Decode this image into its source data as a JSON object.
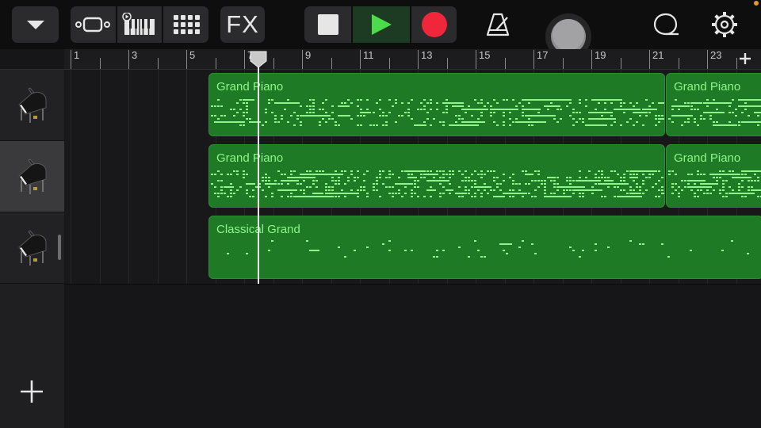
{
  "toolbar": {
    "fx_label": "FX",
    "buttons": [
      {
        "name": "track-menu-button",
        "icon": "chevron-down-icon"
      },
      {
        "name": "browser-button",
        "icon": "browser-icon"
      },
      {
        "name": "instrument-button",
        "icon": "keyboard-icon"
      },
      {
        "name": "smart-controls-button",
        "icon": "grid-icon"
      },
      {
        "name": "fx-button",
        "icon": "fx-icon"
      },
      {
        "name": "stop-button",
        "icon": "stop-icon"
      },
      {
        "name": "play-button",
        "icon": "play-icon"
      },
      {
        "name": "record-button",
        "icon": "record-icon"
      },
      {
        "name": "metronome-button",
        "icon": "metronome-icon"
      },
      {
        "name": "master-volume-knob",
        "icon": "volume-knob-icon"
      },
      {
        "name": "loop-browser-button",
        "icon": "loop-icon"
      },
      {
        "name": "settings-button",
        "icon": "gear-icon"
      }
    ]
  },
  "colors": {
    "region_fill": "#1e7a25",
    "region_text": "#8ff58a",
    "play_green": "#4bdb4b",
    "record_red": "#f0263a",
    "playhead": "#f0f0f0"
  },
  "ruler": {
    "labels": [
      "1",
      "3",
      "5",
      "7",
      "9",
      "11",
      "13",
      "15",
      "17",
      "19",
      "21",
      "23"
    ]
  },
  "playhead_bar": 7.5,
  "tracks": [
    {
      "instrument": "Grand Piano",
      "icon": "grand-piano-icon",
      "selected": false,
      "regions": [
        {
          "title": "Grand Piano"
        },
        {
          "title": "Grand Piano"
        }
      ]
    },
    {
      "instrument": "Grand Piano",
      "icon": "grand-piano-icon",
      "selected": true,
      "regions": [
        {
          "title": "Grand Piano"
        },
        {
          "title": "Grand Piano"
        }
      ]
    },
    {
      "instrument": "Classical Grand",
      "icon": "grand-piano-icon",
      "selected": false,
      "regions": [
        {
          "title": "Classical Grand"
        }
      ]
    }
  ]
}
